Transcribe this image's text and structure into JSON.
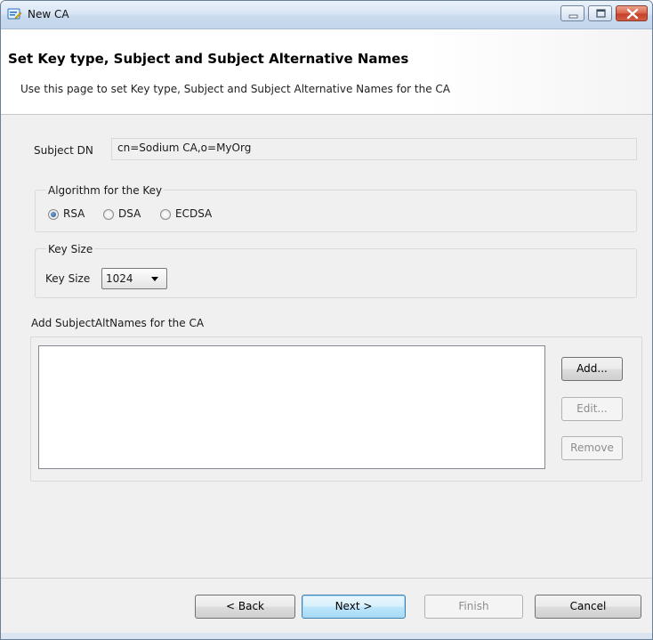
{
  "window": {
    "title": "New CA",
    "colors": {
      "titlebar": "#cadbee",
      "close_button": "#c4402a",
      "default_button": "#bee6fd"
    }
  },
  "header": {
    "title": "Set Key type, Subject and Subject Alternative Names",
    "description": "Use this page to set Key type, Subject and Subject Alternative Names for the CA"
  },
  "subject": {
    "label": "Subject DN",
    "value": "cn=Sodium CA,o=MyOrg"
  },
  "algorithm": {
    "group_label": "Algorithm for the Key",
    "options": [
      "RSA",
      "DSA",
      "ECDSA"
    ],
    "selected": "RSA"
  },
  "key_size": {
    "group_label": "Key Size",
    "label": "Key Size",
    "value": "1024"
  },
  "san": {
    "label": "Add SubjectAltNames for the CA",
    "items": [],
    "add_label": "Add...",
    "edit_label": "Edit...",
    "remove_label": "Remove"
  },
  "footer": {
    "back_label": "< Back",
    "next_label": "Next >",
    "finish_label": "Finish",
    "cancel_label": "Cancel"
  },
  "icons": {
    "app": "certificate-wizard-icon",
    "minimize": "minimize-icon",
    "maximize": "maximize-icon",
    "close": "close-icon",
    "dropdown": "chevron-down-icon"
  }
}
